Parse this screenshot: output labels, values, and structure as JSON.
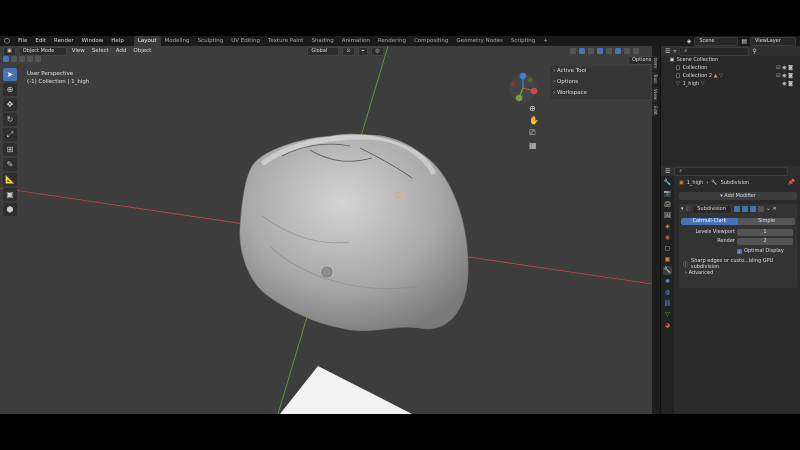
{
  "topbar": {
    "menus": [
      "File",
      "Edit",
      "Render",
      "Window",
      "Help"
    ],
    "workspaces": [
      "Layout",
      "Modeling",
      "Sculpting",
      "UV Editing",
      "Texture Paint",
      "Shading",
      "Animation",
      "Rendering",
      "Compositing",
      "Geometry Nodes",
      "Scripting"
    ],
    "active_workspace": "Layout",
    "add_tab": "+",
    "scene": "Scene",
    "view_layer": "ViewLayer"
  },
  "viewport": {
    "mode": "Object Mode",
    "menus": [
      "View",
      "Select",
      "Add",
      "Object"
    ],
    "transform_orientation": "Global",
    "options_label": "Options",
    "perspective": "User Perspective",
    "collection_info": "(-1) Collection | 1_high",
    "side_panels": [
      "Active Tool",
      "Options",
      "Workspace"
    ],
    "n_tabs": [
      "Item",
      "Tool",
      "View",
      "Edit"
    ],
    "gizmo": {
      "x": "X",
      "y": "Y",
      "z": "Z"
    }
  },
  "outliner": {
    "search_placeholder": "",
    "root": "Scene Collection",
    "rows": [
      {
        "name": "Collection",
        "indent": 1
      },
      {
        "name": "Collection 2",
        "indent": 1
      },
      {
        "name": "1_high",
        "indent": 1
      }
    ]
  },
  "properties": {
    "object_name": "1_high",
    "modifier_name_breadcrumb": "Subdivision",
    "add_modifier": "Add Modifier",
    "modifier": {
      "name": "Subdivision",
      "mode_a": "Catmull-Clark",
      "mode_b": "Simple",
      "levels_viewport_label": "Levels Viewport",
      "levels_viewport_value": "1",
      "render_label": "Render",
      "render_value": "2",
      "optimal_display_label": "Optimal Display",
      "info": "Sharp edges or custo...bling GPU subdivision",
      "advanced_label": "Advanced"
    }
  },
  "colors": {
    "accent": "#4772b3",
    "x_axis": "#c54a4a",
    "y_axis": "#6ea33a",
    "z_axis": "#3e7fd1",
    "viewport_bg": "#3d3d3d"
  }
}
